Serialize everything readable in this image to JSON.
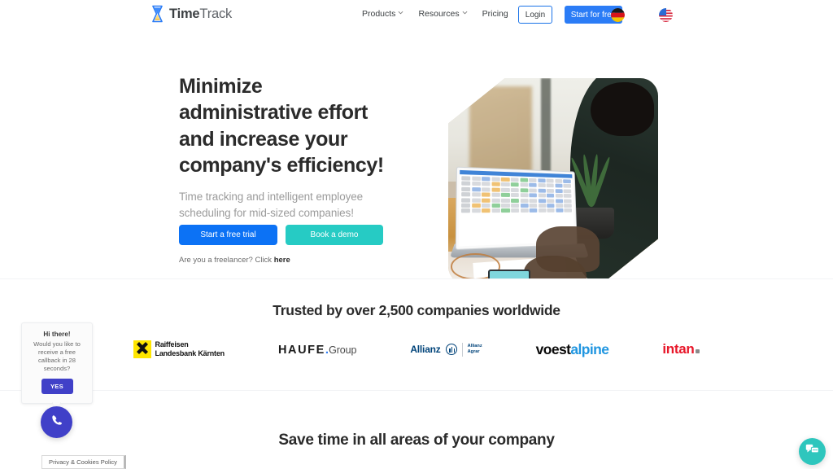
{
  "header": {
    "brand": {
      "name_bold": "Time",
      "name_light": "Track",
      "logo_icon": "hourglass-icon"
    },
    "nav": [
      {
        "label": "Products",
        "has_caret": true
      },
      {
        "label": "Resources",
        "has_caret": true
      },
      {
        "label": "Pricing",
        "has_caret": false
      }
    ],
    "login_label": "Login",
    "start_label": "Start for free",
    "languages": [
      {
        "name": "german-flag-icon",
        "code": "DE"
      },
      {
        "name": "us-flag-icon",
        "code": "US"
      }
    ],
    "accent_blue": "#2b7cf6"
  },
  "hero": {
    "title": "Minimize administrative effort and increase your company's efficiency!",
    "subtitle": "Time tracking and intelligent employee scheduling for mid-sized companies!",
    "cta_primary": "Start a free trial",
    "cta_secondary": "Book a demo",
    "freelancer_text": "Are you a freelancer? Click ",
    "freelancer_link": "here",
    "image_alt": "person-at-laptop-photo",
    "primary_color": "#0c72f5",
    "secondary_color": "#26cbc4"
  },
  "trust": {
    "title": "Trusted by over 2,500 companies worldwide",
    "logos": [
      {
        "id": "raiffeisen",
        "line1": "Raiffeisen",
        "line2": "Landesbank Kärnten",
        "color": "#ffe600"
      },
      {
        "id": "haufe",
        "part1": "HAUFE",
        "dot": ".",
        "part2": "Group",
        "color": "#2b7cf6"
      },
      {
        "id": "allianz",
        "name": "Allianz",
        "sub1": "Allianz",
        "sub2": "Agrar",
        "color": "#00437a"
      },
      {
        "id": "voestalpine",
        "part1": "voest",
        "part2": "alpine",
        "color": "#2196e0"
      },
      {
        "id": "intan",
        "name": "intan",
        "color": "#e8172a"
      }
    ]
  },
  "section2": {
    "title": "Save time in all areas of your company"
  },
  "callback": {
    "heading": "Hi there!",
    "message": "Would you like to receive a free callback in 28 seconds?",
    "button_label": "YES",
    "phone_icon": "phone-icon",
    "accent": "#4040c8"
  },
  "privacy": {
    "label": "Privacy & Cookies Policy"
  },
  "chat": {
    "icon": "chat-bubbles-icon",
    "color": "#2ec6bd"
  }
}
